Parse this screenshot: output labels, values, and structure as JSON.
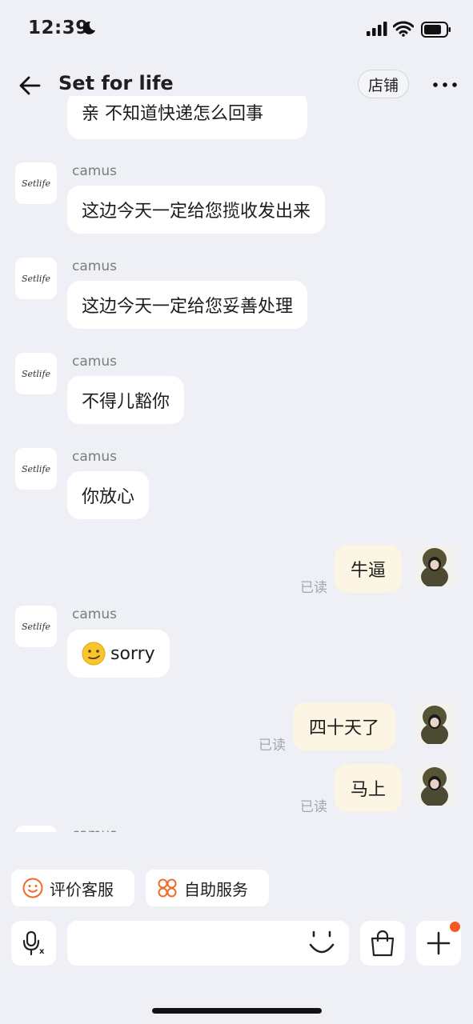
{
  "status_bar": {
    "time": "12:39"
  },
  "header": {
    "title": "Set for life",
    "shop_label": "店铺"
  },
  "messages": {
    "partial_top": "亲 不知道快递怎么回事",
    "sender_name": "camus",
    "avatar_logo_text": "Setlife",
    "m1": "这边今天一定给您揽收发出来",
    "m2": "这边今天一定给您妥善处理",
    "m3": "不得儿豁你",
    "m4": "你放心",
    "r1": "牛逼",
    "m5": "sorry",
    "r2": "四十天了",
    "r3": "马上",
    "read_label": "已读"
  },
  "quick_actions": {
    "rate": "评价客服",
    "self_service": "自助服务"
  },
  "colors": {
    "bg": "#eef0f5",
    "outgoing_bubble": "#fdf5e3",
    "accent": "#f55a1e"
  }
}
